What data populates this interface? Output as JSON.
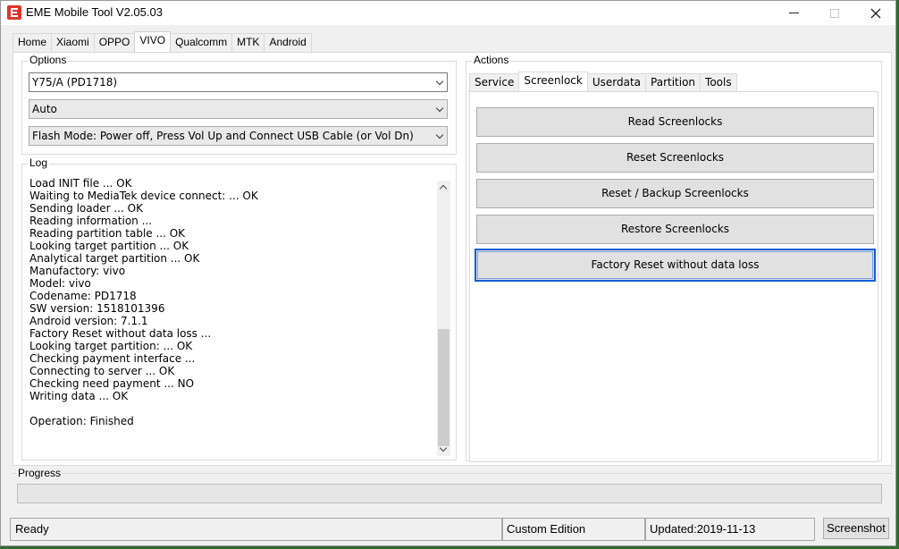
{
  "window": {
    "title": "EME Mobile Tool V2.05.03"
  },
  "main_tabs": [
    "Home",
    "Xiaomi",
    "OPPO",
    "VIVO",
    "Qualcomm",
    "MTK",
    "Android"
  ],
  "options": {
    "label": "Options",
    "model": "Y75/A (PD1718)",
    "mode": "Auto",
    "flash_mode": "Flash Mode: Power off, Press Vol Up and Connect USB Cable (or Vol Dn)"
  },
  "log": {
    "label": "Log",
    "lines": [
      "Load INIT file ... OK",
      "Waiting to MediaTek device connect: ... OK",
      "Sending loader ... OK",
      "Reading information ...",
      "Reading partition table ... OK",
      "Looking target partition ... OK",
      "Analytical target partition ... OK",
      "Manufactory: vivo",
      "Model: vivo",
      "Codename: PD1718",
      "SW version: 1518101396",
      "Android version: 7.1.1",
      "Factory Reset without data loss ...",
      "Looking target partition: ... OK",
      "Checking payment interface ...",
      "Connecting to server ... OK",
      "Checking need payment ... NO",
      "Writing data ... OK",
      "",
      "Operation: Finished"
    ]
  },
  "actions": {
    "label": "Actions",
    "tabs": [
      "Service",
      "Screenlock",
      "Userdata",
      "Partition",
      "Tools"
    ],
    "buttons": [
      "Read Screenlocks",
      "Reset Screenlocks",
      "Reset / Backup Screenlocks",
      "Restore Screenlocks",
      "Factory Reset without data loss"
    ]
  },
  "progress": {
    "label": "Progress",
    "value": 0
  },
  "status": {
    "state": "Ready",
    "edition": "Custom Edition",
    "updated": "Updated:2019-11-13"
  },
  "screenshot_label": "Screenshot",
  "icons": {
    "app": "eme-logo-icon",
    "minimize": "minimize-icon",
    "maximize": "maximize-icon",
    "close": "close-icon"
  },
  "colors": {
    "focus_border": "#0f5fd6",
    "app_icon": "#e0352b"
  }
}
